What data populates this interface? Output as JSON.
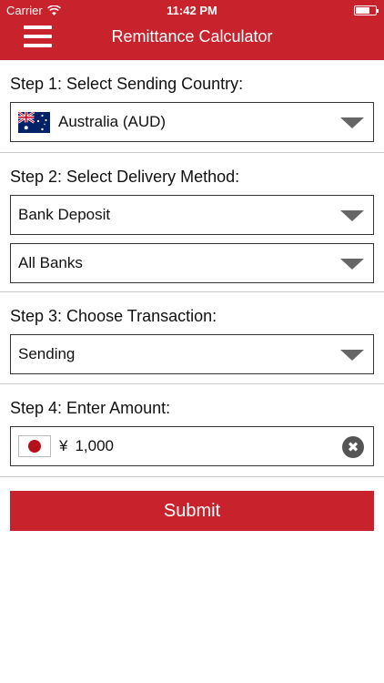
{
  "status_bar": {
    "carrier": "Carrier",
    "time": "11:42 PM",
    "battery_level": 0.7
  },
  "header": {
    "title": "Remittance Calculator",
    "menu_icon": "hamburger-menu-icon"
  },
  "colors": {
    "brand": "#c8222c",
    "caret": "#666666",
    "clear_button": "#555555"
  },
  "step1": {
    "title": "Step 1: Select Sending Country:",
    "country": {
      "flag_icon": "australia-flag-icon",
      "value": "Australia (AUD)"
    }
  },
  "step2": {
    "title": "Step 2: Select Delivery Method:",
    "method": {
      "value": "Bank Deposit"
    },
    "bank": {
      "value": "All Banks"
    }
  },
  "step3": {
    "title": "Step 3: Choose Transaction:",
    "transaction": {
      "value": "Sending"
    }
  },
  "step4": {
    "title": "Step 4: Enter Amount:",
    "amount": {
      "flag_icon": "japan-flag-icon",
      "currency_symbol": "¥",
      "value": "1,000",
      "clear_icon": "clear-circle-icon"
    }
  },
  "submit_label": "Submit"
}
